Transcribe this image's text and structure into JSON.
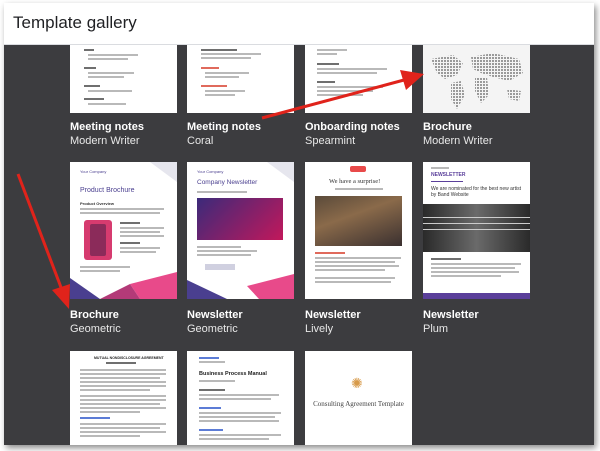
{
  "header": {
    "title": "Template gallery"
  },
  "templates": [
    {
      "title": "Meeting notes",
      "subtitle": "Modern Writer"
    },
    {
      "title": "Meeting notes",
      "subtitle": "Coral"
    },
    {
      "title": "Onboarding notes",
      "subtitle": "Spearmint"
    },
    {
      "title": "Brochure",
      "subtitle": "Modern Writer"
    },
    {
      "title": "Brochure",
      "subtitle": "Geometric"
    },
    {
      "title": "Newsletter",
      "subtitle": "Geometric"
    },
    {
      "title": "Newsletter",
      "subtitle": "Lively"
    },
    {
      "title": "Newsletter",
      "subtitle": "Plum"
    }
  ],
  "thumbs": {
    "brochure_geometric": {
      "company": "Your Company",
      "heading": "Product Brochure",
      "section": "Product Overview"
    },
    "newsletter_geometric": {
      "company": "Your Company",
      "heading": "Company Newsletter"
    },
    "newsletter_lively": {
      "heading": "We have a surprise!"
    },
    "newsletter_plum": {
      "label": "NEWSLETTER",
      "heading": "We are nominated for the best new artist by Band Website"
    },
    "row3_doc1": {
      "heading": "MUTUAL NONDISCLOSURE AGREEMENT"
    },
    "row3_doc2": {
      "heading": "Business Process Manual"
    },
    "row3_doc3": {
      "heading": "Consulting Agreement Template"
    }
  },
  "colors": {
    "background": "#3c3c3f",
    "arrow": "#e0231b",
    "accent_purple": "#6a4fb0",
    "accent_pink": "#e84a8a"
  }
}
